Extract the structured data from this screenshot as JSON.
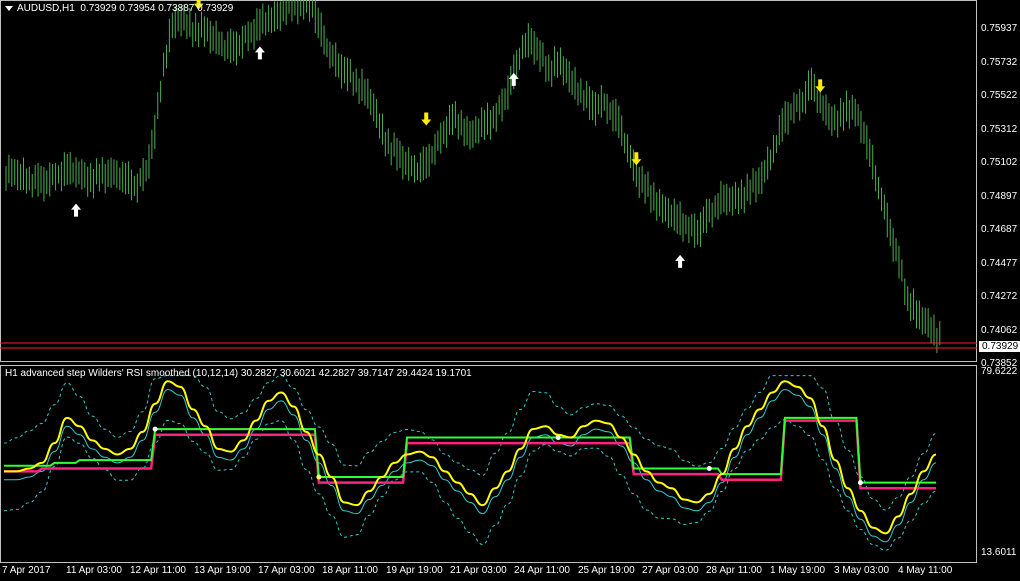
{
  "header": {
    "symbol": "AUDUSD,H1",
    "ohlc": "0.73929 0.73954 0.73887 0.73929"
  },
  "price_axis": [
    "0.75937",
    "0.75732",
    "0.75522",
    "0.75312",
    "0.75102",
    "0.74897",
    "0.74687",
    "0.74477",
    "0.74272",
    "0.74062",
    "0.73852"
  ],
  "current_price": "0.73929",
  "indicator": {
    "title": "H1 advanced step Wilders' RSI smoothed (10,12,14) 30.2827 30.6021 42.2827 39.7147 29.4424 19.1701",
    "max_label": "79.6222",
    "min_label": "13.6011"
  },
  "time_axis": [
    "7 Apr 2017",
    "11 Apr 03:00",
    "12 Apr 11:00",
    "13 Apr 19:00",
    "17 Apr 03:00",
    "18 Apr 11:00",
    "19 Apr 19:00",
    "21 Apr 03:00",
    "24 Apr 11:00",
    "25 Apr 19:00",
    "27 Apr 03:00",
    "28 Apr 11:00",
    "1 May 19:00",
    "3 May 03:00",
    "4 May 11:00"
  ],
  "colors": {
    "bars": "#4caf50",
    "rsi_yellow": "#ffff00",
    "level_magenta": "#ff2080",
    "level_green": "#33ff33",
    "signal_cyan": "#33cccc",
    "price_line": "#ff2020",
    "up_arrow": "#ffffff",
    "down_arrow": "#ffee00"
  },
  "chart_data": {
    "type": "line",
    "price_series": [
      0.7495,
      0.7493,
      0.7491,
      0.7489,
      0.7492,
      0.7494,
      0.7497,
      0.7496,
      0.7493,
      0.7491,
      0.7494,
      0.7496,
      0.7493,
      0.749,
      0.7488,
      0.7496,
      0.752,
      0.756,
      0.7585,
      0.7588,
      0.7584,
      0.7582,
      0.758,
      0.7576,
      0.7572,
      0.757,
      0.7575,
      0.758,
      0.7585,
      0.7588,
      0.759,
      0.7595,
      0.7597,
      0.7598,
      0.7595,
      0.758,
      0.7568,
      0.756,
      0.7555,
      0.755,
      0.7545,
      0.7535,
      0.752,
      0.751,
      0.7505,
      0.75,
      0.7498,
      0.75,
      0.751,
      0.752,
      0.7528,
      0.7524,
      0.7518,
      0.7522,
      0.7526,
      0.753,
      0.754,
      0.7555,
      0.7572,
      0.7575,
      0.7566,
      0.7558,
      0.7562,
      0.7556,
      0.7548,
      0.7542,
      0.7535,
      0.7538,
      0.7534,
      0.7525,
      0.751,
      0.7495,
      0.7486,
      0.748,
      0.7474,
      0.747,
      0.7466,
      0.7462,
      0.746,
      0.7468,
      0.7475,
      0.748,
      0.7478,
      0.7482,
      0.7485,
      0.749,
      0.75,
      0.7515,
      0.7528,
      0.7534,
      0.754,
      0.7548,
      0.7538,
      0.753,
      0.7525,
      0.7535,
      0.7532,
      0.752,
      0.75,
      0.748,
      0.746,
      0.744,
      0.742,
      0.741,
      0.7405,
      0.74,
      0.7393
    ],
    "up_arrows": [
      8,
      29,
      58,
      77
    ],
    "down_arrows": [
      22,
      48,
      72,
      93
    ],
    "ylim": [
      0.73852,
      0.75937
    ],
    "rsi": [
      44,
      44,
      45,
      47,
      54,
      63,
      60,
      55,
      52,
      50,
      52,
      58,
      68,
      76,
      74,
      66,
      60,
      52,
      51,
      55,
      62,
      69,
      72,
      67,
      58,
      50,
      42,
      33,
      32,
      37,
      42,
      47,
      50,
      51,
      49,
      44,
      40,
      36,
      32,
      38,
      44,
      52,
      59,
      60,
      57,
      56,
      60,
      62,
      61,
      56,
      50,
      44,
      40,
      38,
      34,
      33,
      36,
      43,
      52,
      60,
      66,
      72,
      76,
      74,
      70,
      60,
      48,
      38,
      30,
      24,
      22,
      28,
      36,
      44,
      50
    ],
    "level_magenta": [
      44,
      44,
      44,
      45,
      45,
      45,
      45,
      45,
      45,
      45,
      45,
      45,
      57,
      57,
      57,
      57,
      57,
      57,
      57,
      57,
      57,
      57,
      57,
      57,
      57,
      40,
      40,
      40,
      40,
      40,
      40,
      40,
      54,
      54,
      54,
      54,
      54,
      54,
      54,
      54,
      54,
      54,
      54,
      54,
      54,
      54,
      54,
      54,
      54,
      54,
      43,
      43,
      43,
      43,
      43,
      43,
      43,
      41,
      41,
      41,
      41,
      41,
      62,
      62,
      62,
      62,
      62,
      62,
      38,
      38,
      38,
      38,
      38,
      38,
      38
    ],
    "level_green": [
      46,
      46,
      46,
      46,
      47,
      47,
      48,
      48,
      48,
      48,
      48,
      48,
      59,
      59,
      59,
      59,
      59,
      59,
      59,
      59,
      59,
      59,
      59,
      59,
      59,
      42,
      42,
      42,
      42,
      42,
      42,
      42,
      56,
      56,
      56,
      56,
      56,
      56,
      56,
      56,
      56,
      56,
      56,
      56,
      56,
      56,
      56,
      56,
      56,
      56,
      45,
      45,
      45,
      45,
      45,
      45,
      45,
      43,
      43,
      43,
      43,
      43,
      63,
      63,
      63,
      63,
      63,
      63,
      40,
      40,
      40,
      40,
      40,
      40,
      40
    ],
    "indicator_ylim": [
      13.6011,
      79.6222
    ]
  }
}
